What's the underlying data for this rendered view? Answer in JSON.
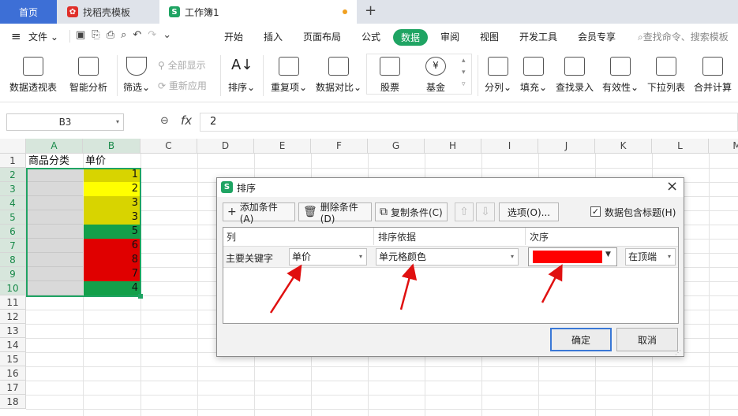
{
  "tabs": {
    "home": "首页",
    "template": "找稻壳模板",
    "workbook": "工作簿1"
  },
  "menu": {
    "file": "文件",
    "items": [
      "开始",
      "插入",
      "页面布局",
      "公式",
      "数据",
      "审阅",
      "视图",
      "开发工具",
      "会员专享"
    ],
    "active": "数据",
    "search": "查找命令、搜索模板"
  },
  "ribbon": {
    "pivot": "数据透视表",
    "smart": "智能分析",
    "filter": "筛选",
    "show_all": "全部显示",
    "reapply": "重新应用",
    "sort": "排序",
    "dup": "重复项",
    "compare": "数据对比",
    "stock": "股票",
    "fund": "基金",
    "split": "分列",
    "fill": "填充",
    "lookup": "查找录入",
    "valid": "有效性",
    "dropdown": "下拉列表",
    "merge": "合并计算"
  },
  "formula": {
    "name_box": "B3",
    "fx": "fx",
    "value": "2"
  },
  "sheet": {
    "columns": [
      "A",
      "B",
      "C",
      "D",
      "E",
      "F",
      "G",
      "H",
      "I",
      "J",
      "K",
      "L",
      "M"
    ],
    "rows": [
      "1",
      "2",
      "3",
      "4",
      "5",
      "6",
      "7",
      "8",
      "9",
      "10",
      "11",
      "12",
      "13",
      "14",
      "15",
      "16",
      "17",
      "18"
    ],
    "header_a": "商品分类",
    "header_b": "单价",
    "b_values": [
      "1",
      "2",
      "3",
      "3",
      "5",
      "6",
      "8",
      "7",
      "4"
    ],
    "b_colors": [
      "#d8d400",
      "#ffff00",
      "#d8d400",
      "#d8d400",
      "#13a04a",
      "#e00000",
      "#e00000",
      "#e00000",
      "#13a04a"
    ]
  },
  "dialog": {
    "title": "排序",
    "add": "添加条件(A)",
    "delete": "删除条件(D)",
    "copy": "复制条件(C)",
    "options": "选项(O)...",
    "has_header": "数据包含标题(H)",
    "col_header": "列",
    "basis_header": "排序依据",
    "order_header": "次序",
    "key_label": "主要关键字",
    "key_value": "单价",
    "basis_value": "单元格颜色",
    "order_color": "#ff0000",
    "position_value": "在顶端",
    "ok": "确定",
    "cancel": "取消"
  }
}
